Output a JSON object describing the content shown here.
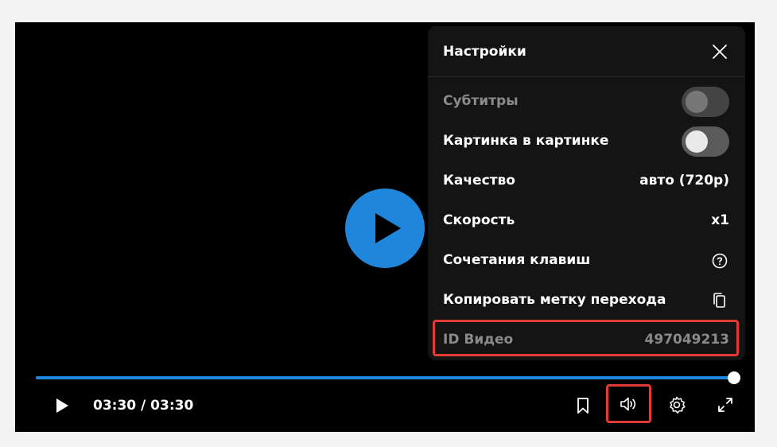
{
  "settings": {
    "title": "Настройки",
    "rows": [
      {
        "label": "Субтитры",
        "type": "toggle",
        "state": "off",
        "disabled": true
      },
      {
        "label": "Картинка в картинке",
        "type": "toggle",
        "state": "off",
        "disabled": false
      },
      {
        "label": "Качество",
        "type": "value",
        "value": "авто (720p)"
      },
      {
        "label": "Скорость",
        "type": "value",
        "value": "x1"
      },
      {
        "label": "Сочетания клавиш",
        "type": "icon",
        "icon": "help-icon"
      },
      {
        "label": "Копировать метку перехода",
        "type": "icon",
        "icon": "copy-icon"
      },
      {
        "label": "ID Видео",
        "type": "value",
        "value": "497049213",
        "highlighted": true
      }
    ]
  },
  "controls": {
    "time_display": "03:30 / 03:30",
    "progress_fraction": 1.0,
    "highlighted_control": "volume-button"
  },
  "colors": {
    "accent": "#1f86db",
    "highlight": "#e23b34",
    "panel_bg": "#141414",
    "player_bg": "#000000"
  }
}
